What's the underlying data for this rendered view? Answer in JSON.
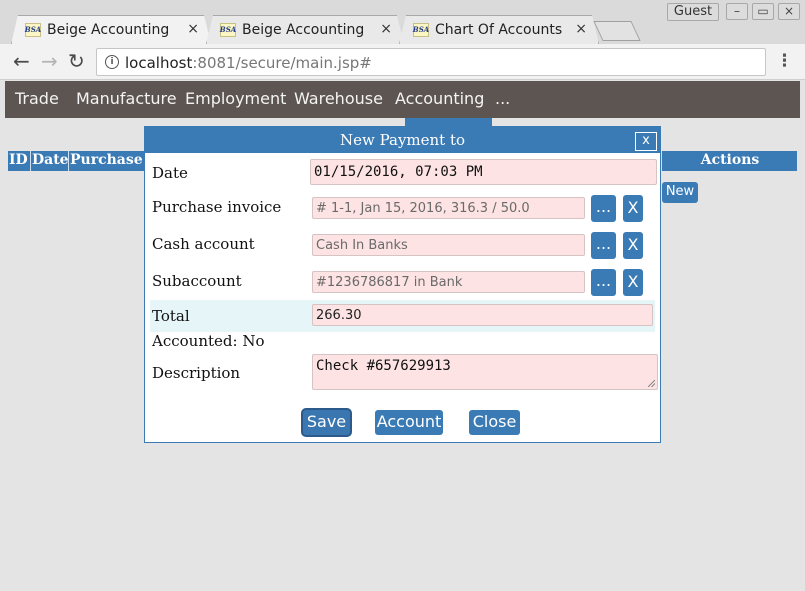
{
  "browser": {
    "tabs": [
      {
        "favicon": "BSA",
        "title": "Beige Accounting",
        "close": "×"
      },
      {
        "favicon": "BSA",
        "title": "Beige Accounting",
        "close": "×"
      },
      {
        "favicon": "BSA",
        "title": "Chart Of Accounts",
        "close": "×"
      }
    ],
    "profile": "Guest",
    "window_controls": {
      "minimize": "–",
      "restore": "▭",
      "close": "×"
    },
    "nav": {
      "back": "←",
      "forward": "→",
      "reload": "↻"
    },
    "address": {
      "info_icon": "i",
      "host": "localhost",
      "rest": ":8081/secure/main.jsp#"
    },
    "menu": "⋮"
  },
  "app_nav": {
    "items": [
      "Trade",
      "Manufacture",
      "Employment",
      "Warehouse",
      "Accounting",
      "..."
    ]
  },
  "table": {
    "headers": {
      "id": "ID",
      "date": "Date",
      "purchase": "Purchase",
      "actions": "Actions"
    },
    "new_button": "New"
  },
  "dialog": {
    "title": "New Payment to",
    "close": "x",
    "fields": {
      "date": {
        "label": "Date",
        "value": "01/15/2016, 07:03 PM"
      },
      "purchase_invoice": {
        "label": "Purchase invoice",
        "value": "# 1-1, Jan 15, 2016, 316.3 / 50.0"
      },
      "cash_account": {
        "label": "Cash account",
        "value": "Cash In Banks"
      },
      "subaccount": {
        "label": "Subaccount",
        "value": "#1236786817 in Bank"
      },
      "total": {
        "label": "Total",
        "value": "266.30"
      },
      "accounted": {
        "label": "Accounted: No"
      },
      "description": {
        "label": "Description",
        "value": "Check #657629913"
      }
    },
    "picker_button": "...",
    "clear_button": "X",
    "buttons": {
      "save": "Save",
      "account": "Account",
      "close": "Close"
    }
  },
  "colors": {
    "accent": "#3a7bb6",
    "nav_bg": "#5d5551",
    "field_bg": "#fde3e3"
  }
}
